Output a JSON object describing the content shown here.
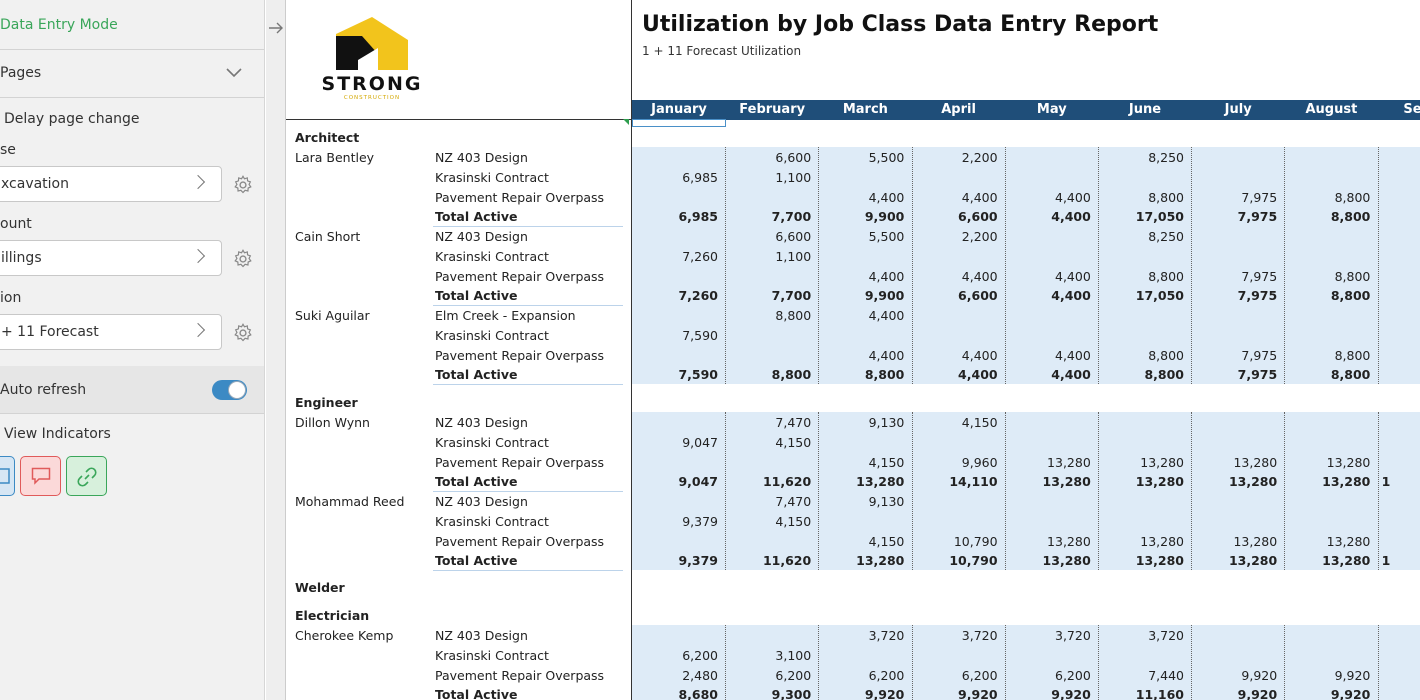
{
  "panel": {
    "mode_label": "Data Entry Mode",
    "pages_label": "Pages",
    "delay_label": "Delay page change",
    "fields": [
      {
        "label": "se",
        "value": "xcavation"
      },
      {
        "label": "ount",
        "value": "illings"
      },
      {
        "label": "ion",
        "value": "+ 11 Forecast"
      }
    ],
    "auto_refresh_label": "Auto refresh",
    "auto_refresh_on": true,
    "view_indicators_label": "View Indicators",
    "indicators": [
      {
        "name": "box-icon",
        "color": "#3c8ac4"
      },
      {
        "name": "comment-icon",
        "color": "#e05a5a"
      },
      {
        "name": "link-icon",
        "color": "#3aa65a"
      }
    ],
    "accent_color": "#3aa65a"
  },
  "report": {
    "logo_text": "STRONG",
    "logo_subtext": "CONSTRUCTION",
    "title": "Utilization by Job Class Data Entry Report",
    "subtitle": "1 + 11 Forecast Utilization",
    "months": [
      "January",
      "February",
      "March",
      "April",
      "May",
      "June",
      "July",
      "August",
      "Septe"
    ],
    "groups": [
      {
        "name": "Architect",
        "people": [
          {
            "name": "Lara Bentley",
            "rows": [
              {
                "label": "NZ 403 Design",
                "values": [
                  "",
                  "6,600",
                  "5,500",
                  "2,200",
                  "",
                  "8,250",
                  "",
                  ""
                ]
              },
              {
                "label": "Krasinski Contract",
                "values": [
                  "6,985",
                  "1,100",
                  "",
                  "",
                  "",
                  "",
                  "",
                  ""
                ]
              },
              {
                "label": "Pavement Repair Overpass",
                "values": [
                  "",
                  "",
                  "4,400",
                  "4,400",
                  "4,400",
                  "8,800",
                  "7,975",
                  "8,800"
                ]
              },
              {
                "label": "Total Active",
                "total": true,
                "values": [
                  "6,985",
                  "7,700",
                  "9,900",
                  "6,600",
                  "4,400",
                  "17,050",
                  "7,975",
                  "8,800"
                ]
              }
            ]
          },
          {
            "name": "Cain Short",
            "rows": [
              {
                "label": "NZ 403 Design",
                "values": [
                  "",
                  "6,600",
                  "5,500",
                  "2,200",
                  "",
                  "8,250",
                  "",
                  ""
                ]
              },
              {
                "label": "Krasinski Contract",
                "values": [
                  "7,260",
                  "1,100",
                  "",
                  "",
                  "",
                  "",
                  "",
                  ""
                ]
              },
              {
                "label": "Pavement Repair Overpass",
                "values": [
                  "",
                  "",
                  "4,400",
                  "4,400",
                  "4,400",
                  "8,800",
                  "7,975",
                  "8,800"
                ]
              },
              {
                "label": "Total Active",
                "total": true,
                "values": [
                  "7,260",
                  "7,700",
                  "9,900",
                  "6,600",
                  "4,400",
                  "17,050",
                  "7,975",
                  "8,800"
                ]
              }
            ]
          },
          {
            "name": "Suki Aguilar",
            "rows": [
              {
                "label": "Elm Creek - Expansion",
                "values": [
                  "",
                  "8,800",
                  "4,400",
                  "",
                  "",
                  "",
                  "",
                  ""
                ]
              },
              {
                "label": "Krasinski Contract",
                "values": [
                  "7,590",
                  "",
                  "",
                  "",
                  "",
                  "",
                  "",
                  ""
                ]
              },
              {
                "label": "Pavement Repair Overpass",
                "values": [
                  "",
                  "",
                  "4,400",
                  "4,400",
                  "4,400",
                  "8,800",
                  "7,975",
                  "8,800"
                ]
              },
              {
                "label": "Total Active",
                "total": true,
                "values": [
                  "7,590",
                  "8,800",
                  "8,800",
                  "4,400",
                  "4,400",
                  "8,800",
                  "7,975",
                  "8,800"
                ]
              }
            ]
          }
        ]
      },
      {
        "name": "Engineer",
        "people": [
          {
            "name": "Dillon Wynn",
            "rows": [
              {
                "label": "NZ 403 Design",
                "values": [
                  "",
                  "7,470",
                  "9,130",
                  "4,150",
                  "",
                  "",
                  "",
                  ""
                ]
              },
              {
                "label": "Krasinski Contract",
                "values": [
                  "9,047",
                  "4,150",
                  "",
                  "",
                  "",
                  "",
                  "",
                  ""
                ]
              },
              {
                "label": "Pavement Repair Overpass",
                "values": [
                  "",
                  "",
                  "4,150",
                  "9,960",
                  "13,280",
                  "13,280",
                  "13,280",
                  "13,280"
                ]
              },
              {
                "label": "Total Active",
                "total": true,
                "values": [
                  "9,047",
                  "11,620",
                  "13,280",
                  "14,110",
                  "13,280",
                  "13,280",
                  "13,280",
                  "13,280"
                ],
                "extra": "1"
              }
            ]
          },
          {
            "name": "Mohammad Reed",
            "rows": [
              {
                "label": "NZ 403 Design",
                "values": [
                  "",
                  "7,470",
                  "9,130",
                  "",
                  "",
                  "",
                  "",
                  ""
                ]
              },
              {
                "label": "Krasinski Contract",
                "values": [
                  "9,379",
                  "4,150",
                  "",
                  "",
                  "",
                  "",
                  "",
                  ""
                ]
              },
              {
                "label": "Pavement Repair Overpass",
                "values": [
                  "",
                  "",
                  "4,150",
                  "10,790",
                  "13,280",
                  "13,280",
                  "13,280",
                  "13,280"
                ]
              },
              {
                "label": "Total Active",
                "total": true,
                "values": [
                  "9,379",
                  "11,620",
                  "13,280",
                  "10,790",
                  "13,280",
                  "13,280",
                  "13,280",
                  "13,280"
                ],
                "extra": "1"
              }
            ]
          }
        ]
      },
      {
        "name": "Welder",
        "people": []
      },
      {
        "name": "Electrician",
        "people": [
          {
            "name": "Cherokee Kemp",
            "rows": [
              {
                "label": "NZ 403 Design",
                "values": [
                  "",
                  "",
                  "3,720",
                  "3,720",
                  "3,720",
                  "3,720",
                  "",
                  ""
                ]
              },
              {
                "label": "Krasinski Contract",
                "values": [
                  "6,200",
                  "3,100",
                  "",
                  "",
                  "",
                  "",
                  "",
                  ""
                ]
              },
              {
                "label": "Pavement Repair Overpass",
                "values": [
                  "2,480",
                  "6,200",
                  "6,200",
                  "6,200",
                  "6,200",
                  "7,440",
                  "9,920",
                  "9,920"
                ]
              },
              {
                "label": "Total Active",
                "total": true,
                "values": [
                  "8,680",
                  "9,300",
                  "9,920",
                  "9,920",
                  "9,920",
                  "11,160",
                  "9,920",
                  "9,920"
                ]
              }
            ]
          }
        ]
      }
    ]
  }
}
